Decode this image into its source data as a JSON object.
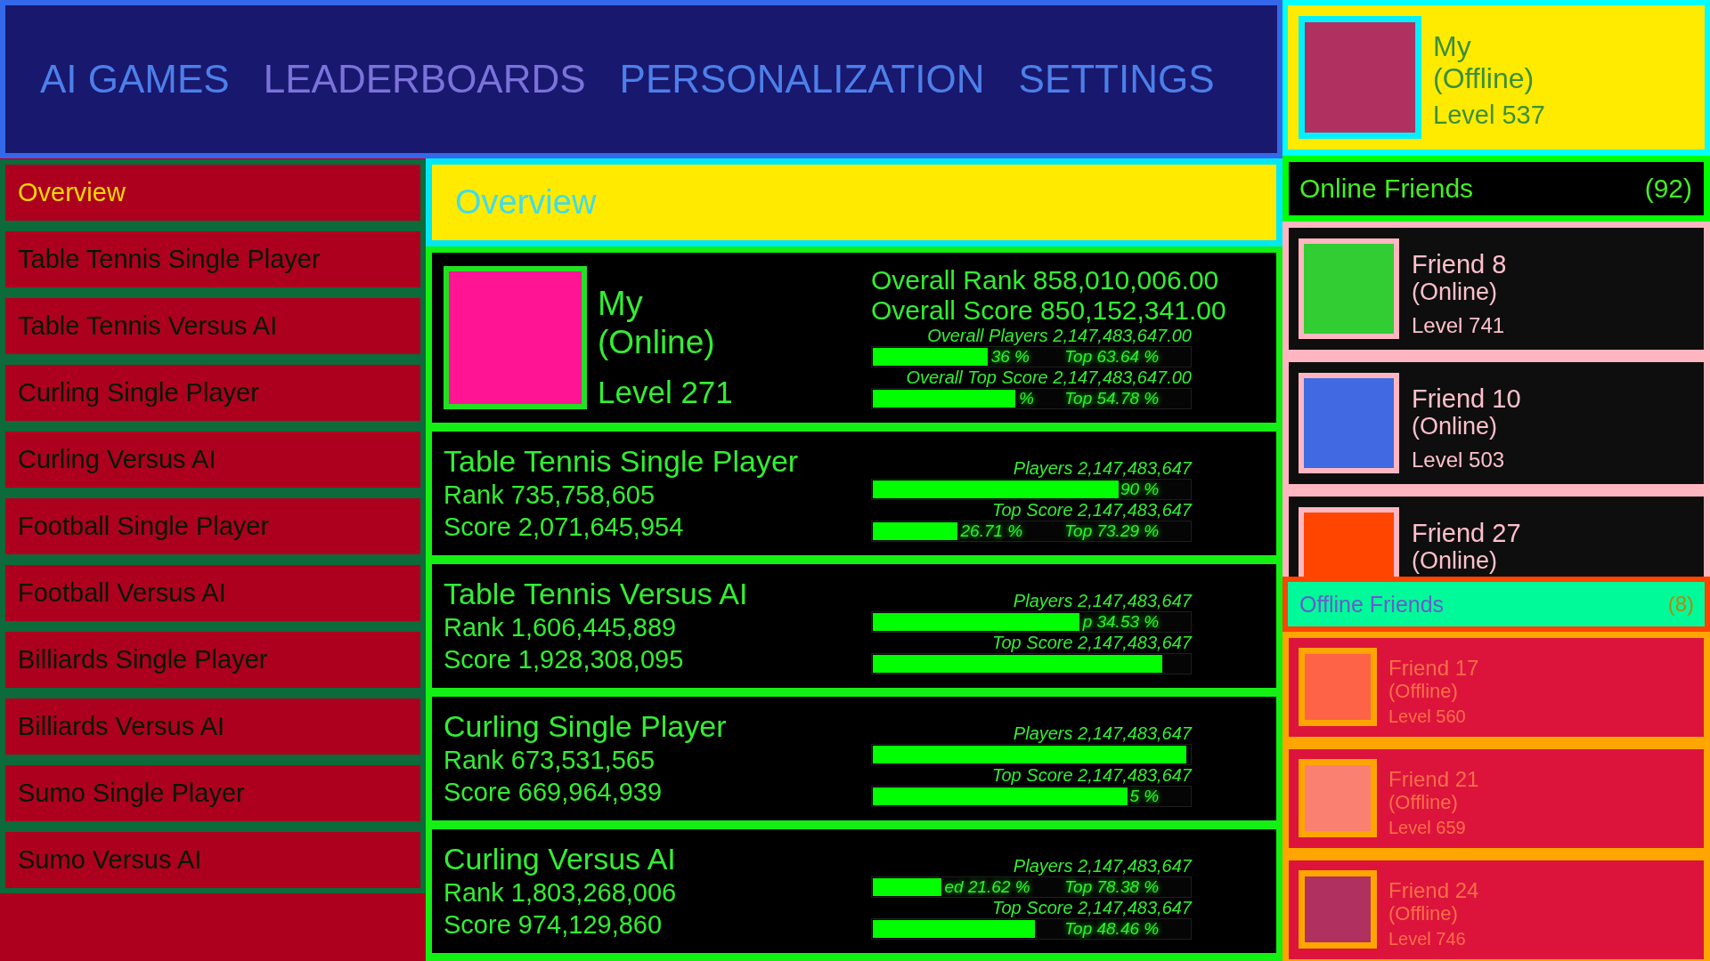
{
  "nav": {
    "tabs": [
      {
        "label": "AI GAMES",
        "selected": false
      },
      {
        "label": "LEADERBOARDS",
        "selected": true
      },
      {
        "label": "PERSONALIZATION",
        "selected": false
      },
      {
        "label": "SETTINGS",
        "selected": false
      }
    ]
  },
  "profile": {
    "name": "My",
    "status": "(Offline)",
    "level": "Level 537"
  },
  "sidebar": {
    "items": [
      {
        "label": "Overview",
        "selected": true
      },
      {
        "label": "Table Tennis Single Player",
        "selected": false
      },
      {
        "label": "Table Tennis Versus AI",
        "selected": false
      },
      {
        "label": "Curling Single Player",
        "selected": false
      },
      {
        "label": "Curling Versus AI",
        "selected": false
      },
      {
        "label": "Football Single Player",
        "selected": false
      },
      {
        "label": "Football Versus AI",
        "selected": false
      },
      {
        "label": "Billiards Single Player",
        "selected": false
      },
      {
        "label": "Billiards Versus AI",
        "selected": false
      },
      {
        "label": "Sumo Single Player",
        "selected": false
      },
      {
        "label": "Sumo Versus AI",
        "selected": false
      }
    ]
  },
  "overview": {
    "title": "Overview",
    "summary": {
      "name": "My",
      "status": "(Online)",
      "level": "Level 271",
      "rank": "Overall Rank 858,010,006.00",
      "score": "Overall Score 850,152,341.00",
      "bars": [
        {
          "label": "Overall Players 2,147,483,647.00",
          "level": 0.3636,
          "left_reading": "36 %",
          "right_reading": "Top 63.64 %"
        },
        {
          "label": "Overall Top Score 2,147,483,647.00",
          "level": 0.4522,
          "left_reading": "%",
          "right_reading": "Top 54.78 %"
        }
      ]
    },
    "games": [
      {
        "title": "Table Tennis Single Player",
        "rank": "Rank 735,758,605",
        "score": "Score 2,071,645,954",
        "bars": [
          {
            "label": "Players 2,147,483,647",
            "level": 0.781,
            "right_reading": "90 %"
          },
          {
            "label": "Top Score 2,147,483,647",
            "level": 0.2671,
            "left_reading": "26.71 %",
            "right_reading": "Top 73.29 %"
          }
        ]
      },
      {
        "title": "Table Tennis Versus AI",
        "rank": "Rank 1,606,445,889",
        "score": "Score 1,928,308,095",
        "bars": [
          {
            "label": "Players 2,147,483,647",
            "level": 0.6547,
            "right_reading": "p 34.53 %"
          },
          {
            "label": "Top Score 2,147,483,647",
            "level": 0.917
          }
        ]
      },
      {
        "title": "Curling Single Player",
        "rank": "Rank 673,531,565",
        "score": "Score 669,964,939",
        "bars": [
          {
            "label": "Players 2,147,483,647",
            "level": 0.995
          },
          {
            "label": "Top Score 2,147,483,647",
            "level": 0.8255,
            "right_reading": "5 %"
          }
        ]
      },
      {
        "title": "Curling Versus AI",
        "rank": "Rank 1,803,268,006",
        "score": "Score 974,129,860",
        "bars": [
          {
            "label": "Players 2,147,483,647",
            "level": 0.2162,
            "left_reading": "ed 21.62 %",
            "right_reading": "Top 78.38 %"
          },
          {
            "label": "Top Score 2,147,483,647",
            "level": 0.5154,
            "right_reading": "Top 48.46 %"
          }
        ]
      }
    ]
  },
  "online_friends": {
    "title": "Online Friends",
    "count": "(92)",
    "items": [
      {
        "name": "Friend 8",
        "status": "(Online)",
        "level": "Level 741",
        "color": "#32cd32"
      },
      {
        "name": "Friend 10",
        "status": "(Online)",
        "level": "Level 503",
        "color": "#4169e1"
      },
      {
        "name": "Friend 27",
        "status": "(Online)",
        "color": "#ff4500"
      }
    ]
  },
  "offline_friends": {
    "title": "Offline Friends",
    "count": "(8)",
    "items": [
      {
        "name": "Friend 17",
        "status": "(Offline)",
        "level": "Level 560",
        "color": "#ff6347"
      },
      {
        "name": "Friend 21",
        "status": "(Offline)",
        "level": "Level 659",
        "color": "#fa8072"
      },
      {
        "name": "Friend 24",
        "status": "(Offline)",
        "level": "Level 746",
        "color": "#b03060"
      }
    ]
  }
}
